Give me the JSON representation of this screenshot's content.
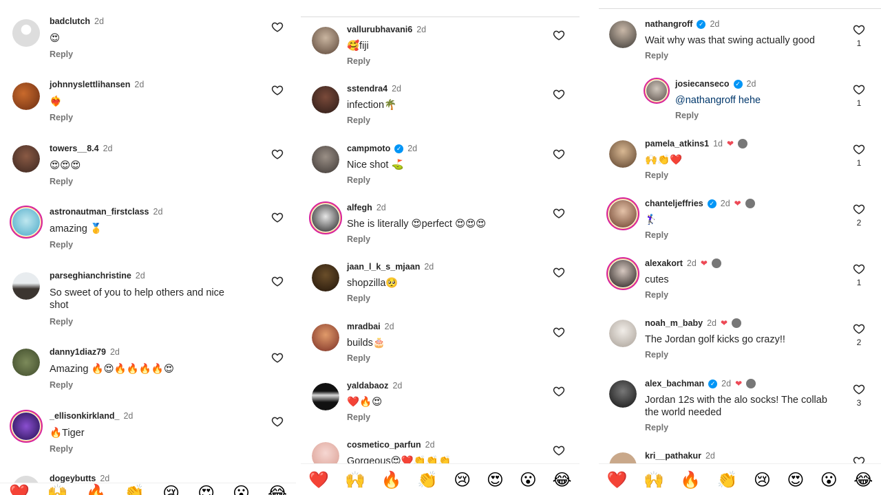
{
  "panel1": {
    "comments": [
      {
        "user": "badclutch",
        "time": "2d",
        "text": "😍",
        "reply": "Reply",
        "likes": ""
      },
      {
        "user": "johnnyslettlihansen",
        "time": "2d",
        "text": "❤️‍🔥",
        "reply": "Reply",
        "likes": ""
      },
      {
        "user": "towers__8.4",
        "time": "2d",
        "text": "😍😍😍",
        "reply": "Reply",
        "likes": ""
      },
      {
        "user": "astronautman_firstclass",
        "time": "2d",
        "text": "amazing 🥇",
        "reply": "Reply",
        "likes": ""
      },
      {
        "user": "parseghianchristine",
        "time": "2d",
        "text": "So sweet of you to help others and nice\nshot",
        "reply": "Reply",
        "likes": ""
      },
      {
        "user": "danny1diaz79",
        "time": "2d",
        "text": "Amazing 🔥😍🔥🔥🔥🔥😍",
        "reply": "Reply",
        "likes": ""
      },
      {
        "user": "_ellisonkirkland_",
        "time": "2d",
        "text": "🔥Tiger",
        "reply": "Reply",
        "likes": ""
      },
      {
        "user": "dogeybutts",
        "time": "2d",
        "text": "",
        "reply": "",
        "likes": ""
      }
    ]
  },
  "panel2": {
    "comments": [
      {
        "user": "vallurubhavani6",
        "time": "2d",
        "text": "🥰fiji",
        "reply": "Reply",
        "likes": ""
      },
      {
        "user": "sstendra4",
        "time": "2d",
        "text": "infection🌴",
        "reply": "Reply",
        "likes": ""
      },
      {
        "user": "campmoto",
        "time": "2d",
        "text": "Nice shot ⛳",
        "reply": "Reply",
        "likes": ""
      },
      {
        "user": "alfegh",
        "time": "2d",
        "text": "She is literally 😍perfect 😍😍😍",
        "reply": "Reply",
        "likes": ""
      },
      {
        "user": "jaan_l_k_s_mjaan",
        "time": "2d",
        "text": "shopzilla🥺",
        "reply": "Reply",
        "likes": ""
      },
      {
        "user": "mradbai",
        "time": "2d",
        "text": "builds🎂",
        "reply": "Reply",
        "likes": ""
      },
      {
        "user": "yaldabaoz",
        "time": "2d",
        "text": "❤️🔥😍",
        "reply": "Reply",
        "likes": ""
      },
      {
        "user": "cosmetico_parfun",
        "time": "2d",
        "text": "Gorgeous😍❤️👏👏👏",
        "reply": "",
        "likes": ""
      }
    ],
    "reaction_bar": [
      "❤️",
      "🙌",
      "🔥",
      "👏",
      "😢",
      "😍",
      "😮",
      "😂"
    ]
  },
  "panel3": {
    "comments": [
      {
        "user": "nathangroff",
        "time": "2d",
        "text": "Wait why was that swing actually good",
        "reply": "Reply",
        "likes": "1"
      },
      {
        "user": "josiecanseco",
        "time": "2d",
        "text": "@nathangroff hehe",
        "reply": "Reply",
        "likes": "1"
      },
      {
        "user": "pamela_atkins1",
        "time": "1d",
        "text": "🙌👏❤️",
        "reply": "Reply",
        "likes": "1"
      },
      {
        "user": "chanteljeffries",
        "time": "2d",
        "text": "🏌️‍♀️",
        "reply": "Reply",
        "likes": "2"
      },
      {
        "user": "alexakort",
        "time": "2d",
        "text": "cutes",
        "reply": "Reply",
        "likes": "1"
      },
      {
        "user": "noah_m_baby",
        "time": "2d",
        "text": "The Jordan golf kicks go crazy!!",
        "reply": "Reply",
        "likes": "2"
      },
      {
        "user": "alex_bachman",
        "time": "2d",
        "text": "Jordan 12s with the alo socks! The collab\nthe world needed",
        "reply": "Reply",
        "likes": "3"
      },
      {
        "user": "kri__pathakur",
        "time": "2d",
        "text": "",
        "reply": "",
        "likes": ""
      }
    ],
    "reaction_bar": [
      "❤️",
      "🙌",
      "🔥",
      "👏",
      "😢",
      "😍",
      "😮",
      "😂"
    ]
  },
  "panel1_bar": [
    "❤️",
    "🙌",
    "🔥",
    "👏",
    "😢",
    "😍",
    "😮",
    "😂"
  ],
  "colors": {
    "verified": "#0095f6",
    "heart_red": "#ed4956",
    "muted": "#737373"
  }
}
